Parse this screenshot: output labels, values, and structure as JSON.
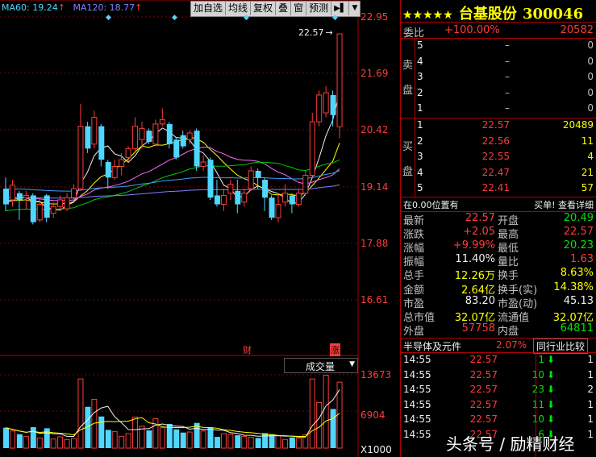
{
  "ma_legend": {
    "ma60": "MA60: 19.24",
    "ma60_arrow": "↑",
    "ma120": "MA120: 18.77",
    "ma120_arrow": "↑"
  },
  "toolbar": {
    "items": [
      "加自选",
      "均线",
      "复权",
      "叠",
      "窗",
      "预测"
    ],
    "next_icon": "▶▌",
    "dropdown_icon": "▼"
  },
  "stock": {
    "stars": "★★★★★",
    "name": "台基股份",
    "code": "300046"
  },
  "price_axis": [
    "22.95",
    "21.69",
    "20.42",
    "19.14",
    "17.88",
    "16.61"
  ],
  "high_marker": "22.57",
  "event_marks": {
    "cai": "财",
    "zhang": "涨"
  },
  "volume": {
    "selector_label": "成交量",
    "axis": [
      "13673",
      "6904",
      "X1000"
    ]
  },
  "weibi": {
    "label": "委比",
    "value": "+100.00%",
    "diff": "20582"
  },
  "sell_side": {
    "label": [
      "卖",
      "盘"
    ],
    "rows": [
      {
        "level": "5",
        "price": "–",
        "vol": "0"
      },
      {
        "level": "4",
        "price": "–",
        "vol": "0"
      },
      {
        "level": "3",
        "price": "–",
        "vol": "0"
      },
      {
        "level": "2",
        "price": "–",
        "vol": "0"
      },
      {
        "level": "1",
        "price": "–",
        "vol": "0"
      }
    ]
  },
  "buy_side": {
    "label": [
      "买",
      "盘"
    ],
    "rows": [
      {
        "level": "1",
        "price": "22.57",
        "vol": "20489"
      },
      {
        "level": "2",
        "price": "22.56",
        "vol": "11"
      },
      {
        "level": "3",
        "price": "22.55",
        "vol": "4"
      },
      {
        "level": "4",
        "price": "22.47",
        "vol": "21"
      },
      {
        "level": "5",
        "price": "22.41",
        "vol": "57"
      }
    ]
  },
  "position_bar": {
    "left": "在0.00位置有",
    "right": "买单! 查看详细"
  },
  "quote": [
    {
      "l1": "最新",
      "v1": "22.57",
      "l2": "开盘",
      "v2": "20.49",
      "c1": "red",
      "c2": "green"
    },
    {
      "l1": "涨跌",
      "v1": "+2.05",
      "l2": "最高",
      "v2": "22.57",
      "c1": "red",
      "c2": "red"
    },
    {
      "l1": "涨幅",
      "v1": "+9.99%",
      "l2": "最低",
      "v2": "20.23",
      "c1": "red",
      "c2": "green"
    },
    {
      "l1": "振幅",
      "v1": "11.40%",
      "l2": "量比",
      "v2": "1.63",
      "c1": "white",
      "c2": "red"
    },
    {
      "l1": "总手",
      "v1": "12.26万",
      "l2": "换手",
      "v2": "8.63%",
      "c1": "yellow",
      "c2": "yellow"
    },
    {
      "l1": "金额",
      "v1": "2.64亿",
      "l2": "换手(实)",
      "v2": "14.38%",
      "c1": "yellow",
      "c2": "yellow"
    },
    {
      "l1": "市盈",
      "v1": "83.20",
      "l2": "市盈(动)",
      "v2": "45.13",
      "c1": "white",
      "c2": "white"
    },
    {
      "l1": "总市值",
      "v1": "32.07亿",
      "l2": "流通值",
      "v2": "32.07亿",
      "c1": "yellow",
      "c2": "yellow"
    },
    {
      "l1": "外盘",
      "v1": "57758",
      "l2": "内盘",
      "v2": "64811",
      "c1": "red",
      "c2": "green"
    }
  ],
  "sector": {
    "name": "半导体及元件",
    "pct": "2.07%",
    "compare": "同行业比较"
  },
  "ticks": [
    {
      "time": "14:55",
      "price": "22.57",
      "vol": "1",
      "n": "1"
    },
    {
      "time": "14:55",
      "price": "22.57",
      "vol": "10",
      "n": "1"
    },
    {
      "time": "14:55",
      "price": "22.57",
      "vol": "23",
      "n": "2"
    },
    {
      "time": "14:55",
      "price": "22.57",
      "vol": "11",
      "n": "1"
    },
    {
      "time": "14:55",
      "price": "22.57",
      "vol": "10",
      "n": "1"
    },
    {
      "time": "14:55",
      "price": "22.57",
      "vol": "6",
      "n": "1"
    }
  ],
  "watermark": "头条号 / 励精财经",
  "colors": {
    "up": "#ff3b3b",
    "down": "#4fd7ff",
    "grid": "#b00000",
    "ma5": "#f0f0f0",
    "ma10": "#ffff00",
    "ma20": "#ff66ff",
    "ma30": "#00cc00",
    "ma60": "#3aa0ff",
    "ma120": "#8080ff"
  },
  "candles": [
    {
      "o": 19.1,
      "c": 18.75,
      "h": 19.35,
      "l": 18.6
    },
    {
      "o": 18.85,
      "c": 19.18,
      "h": 19.3,
      "l": 18.7
    },
    {
      "o": 19.0,
      "c": 18.85,
      "h": 19.05,
      "l": 18.4
    },
    {
      "o": 18.9,
      "c": 18.95,
      "h": 19.05,
      "l": 18.65
    },
    {
      "o": 18.95,
      "c": 18.35,
      "h": 19.0,
      "l": 18.3
    },
    {
      "o": 18.4,
      "c": 18.75,
      "h": 18.9,
      "l": 18.35
    },
    {
      "o": 18.95,
      "c": 18.45,
      "h": 18.98,
      "l": 18.35
    },
    {
      "o": 18.55,
      "c": 18.7,
      "h": 18.8,
      "l": 18.45
    },
    {
      "o": 18.7,
      "c": 18.85,
      "h": 18.95,
      "l": 18.6
    },
    {
      "o": 18.65,
      "c": 18.9,
      "h": 19.0,
      "l": 18.6
    },
    {
      "o": 18.9,
      "c": 19.1,
      "h": 19.2,
      "l": 18.85
    },
    {
      "o": 19.1,
      "c": 20.5,
      "h": 21.0,
      "l": 19.05
    },
    {
      "o": 20.5,
      "c": 20.0,
      "h": 20.6,
      "l": 19.9
    },
    {
      "o": 20.1,
      "c": 20.7,
      "h": 20.85,
      "l": 20.0
    },
    {
      "o": 20.5,
      "c": 19.75,
      "h": 20.55,
      "l": 19.6
    },
    {
      "o": 19.7,
      "c": 19.35,
      "h": 19.75,
      "l": 19.1
    },
    {
      "o": 19.35,
      "c": 19.6,
      "h": 19.75,
      "l": 19.3
    },
    {
      "o": 19.6,
      "c": 19.75,
      "h": 19.9,
      "l": 19.4
    },
    {
      "o": 19.8,
      "c": 20.0,
      "h": 20.05,
      "l": 19.7
    },
    {
      "o": 20.0,
      "c": 20.5,
      "h": 20.7,
      "l": 19.9
    },
    {
      "o": 20.2,
      "c": 20.45,
      "h": 20.6,
      "l": 20.0
    },
    {
      "o": 20.4,
      "c": 20.15,
      "h": 20.45,
      "l": 20.1
    },
    {
      "o": 20.1,
      "c": 20.55,
      "h": 20.65,
      "l": 20.05
    },
    {
      "o": 20.55,
      "c": 20.65,
      "h": 20.9,
      "l": 20.5
    },
    {
      "o": 20.55,
      "c": 20.1,
      "h": 20.6,
      "l": 20.0
    },
    {
      "o": 20.2,
      "c": 19.8,
      "h": 20.25,
      "l": 19.75
    },
    {
      "o": 20.3,
      "c": 20.05,
      "h": 20.4,
      "l": 20.0
    },
    {
      "o": 20.2,
      "c": 20.35,
      "h": 20.4,
      "l": 20.1
    },
    {
      "o": 20.4,
      "c": 19.6,
      "h": 20.45,
      "l": 19.5
    },
    {
      "o": 19.6,
      "c": 19.7,
      "h": 19.85,
      "l": 19.5
    },
    {
      "o": 19.75,
      "c": 18.9,
      "h": 19.8,
      "l": 18.85
    },
    {
      "o": 18.95,
      "c": 18.75,
      "h": 19.3,
      "l": 18.7
    },
    {
      "o": 18.75,
      "c": 18.95,
      "h": 19.1,
      "l": 18.6
    },
    {
      "o": 19.0,
      "c": 19.2,
      "h": 19.3,
      "l": 18.85
    },
    {
      "o": 19.05,
      "c": 18.75,
      "h": 19.3,
      "l": 18.55
    },
    {
      "o": 18.8,
      "c": 19.0,
      "h": 19.1,
      "l": 18.7
    },
    {
      "o": 19.1,
      "c": 19.5,
      "h": 19.6,
      "l": 19.05
    },
    {
      "o": 19.5,
      "c": 19.35,
      "h": 19.55,
      "l": 19.1
    },
    {
      "o": 19.3,
      "c": 18.9,
      "h": 19.35,
      "l": 18.6
    },
    {
      "o": 18.9,
      "c": 18.45,
      "h": 18.95,
      "l": 18.4
    },
    {
      "o": 18.45,
      "c": 18.75,
      "h": 19.0,
      "l": 18.35
    },
    {
      "o": 18.8,
      "c": 19.0,
      "h": 19.2,
      "l": 18.7
    },
    {
      "o": 18.95,
      "c": 18.75,
      "h": 19.0,
      "l": 18.55
    },
    {
      "o": 18.75,
      "c": 19.0,
      "h": 19.1,
      "l": 18.7
    },
    {
      "o": 19.0,
      "c": 19.4,
      "h": 19.5,
      "l": 18.95
    },
    {
      "o": 19.4,
      "c": 20.6,
      "h": 20.8,
      "l": 19.35
    },
    {
      "o": 20.6,
      "c": 21.2,
      "h": 21.3,
      "l": 20.5
    },
    {
      "o": 20.8,
      "c": 21.25,
      "h": 21.4,
      "l": 20.7
    },
    {
      "o": 21.2,
      "c": 20.75,
      "h": 21.3,
      "l": 20.5
    },
    {
      "o": 20.49,
      "c": 22.57,
      "h": 22.57,
      "l": 20.23
    }
  ],
  "volumes": [
    3800,
    3200,
    2600,
    2200,
    3900,
    1900,
    3700,
    1700,
    2100,
    1600,
    1800,
    12900,
    7700,
    9100,
    5900,
    3400,
    3100,
    2200,
    2700,
    5800,
    4100,
    3300,
    5500,
    3800,
    4500,
    3500,
    2900,
    3000,
    4700,
    3200,
    3900,
    2100,
    2700,
    2600,
    2400,
    2200,
    2000,
    1900,
    2800,
    2600,
    2300,
    1600,
    2000,
    1900,
    2500,
    12900,
    8500,
    13600,
    7300,
    12300
  ]
}
